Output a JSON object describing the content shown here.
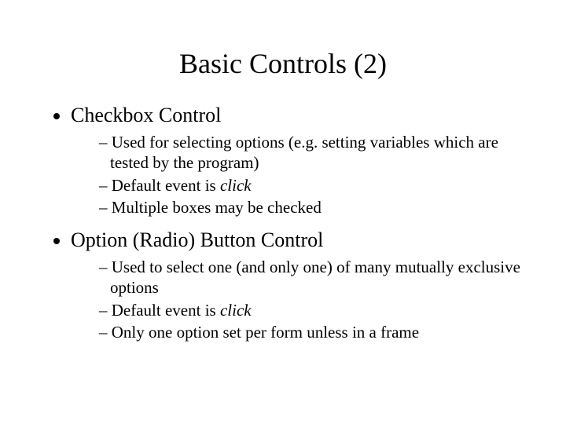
{
  "title": "Basic Controls (2)",
  "bullets": [
    {
      "label": "Checkbox Control",
      "sub": [
        {
          "pre": "Used for selecting options (e.g. setting variables which are tested by the program)",
          "italic": "",
          "post": ""
        },
        {
          "pre": "Default event is ",
          "italic": "click",
          "post": ""
        },
        {
          "pre": "Multiple boxes may be checked",
          "italic": "",
          "post": ""
        }
      ]
    },
    {
      "label": "Option (Radio) Button Control",
      "sub": [
        {
          "pre": "Used to select one (and only one) of many mutually exclusive options",
          "italic": "",
          "post": ""
        },
        {
          "pre": "Default event is ",
          "italic": "click",
          "post": ""
        },
        {
          "pre": "Only one option set per form unless in a frame",
          "italic": "",
          "post": ""
        }
      ]
    }
  ]
}
